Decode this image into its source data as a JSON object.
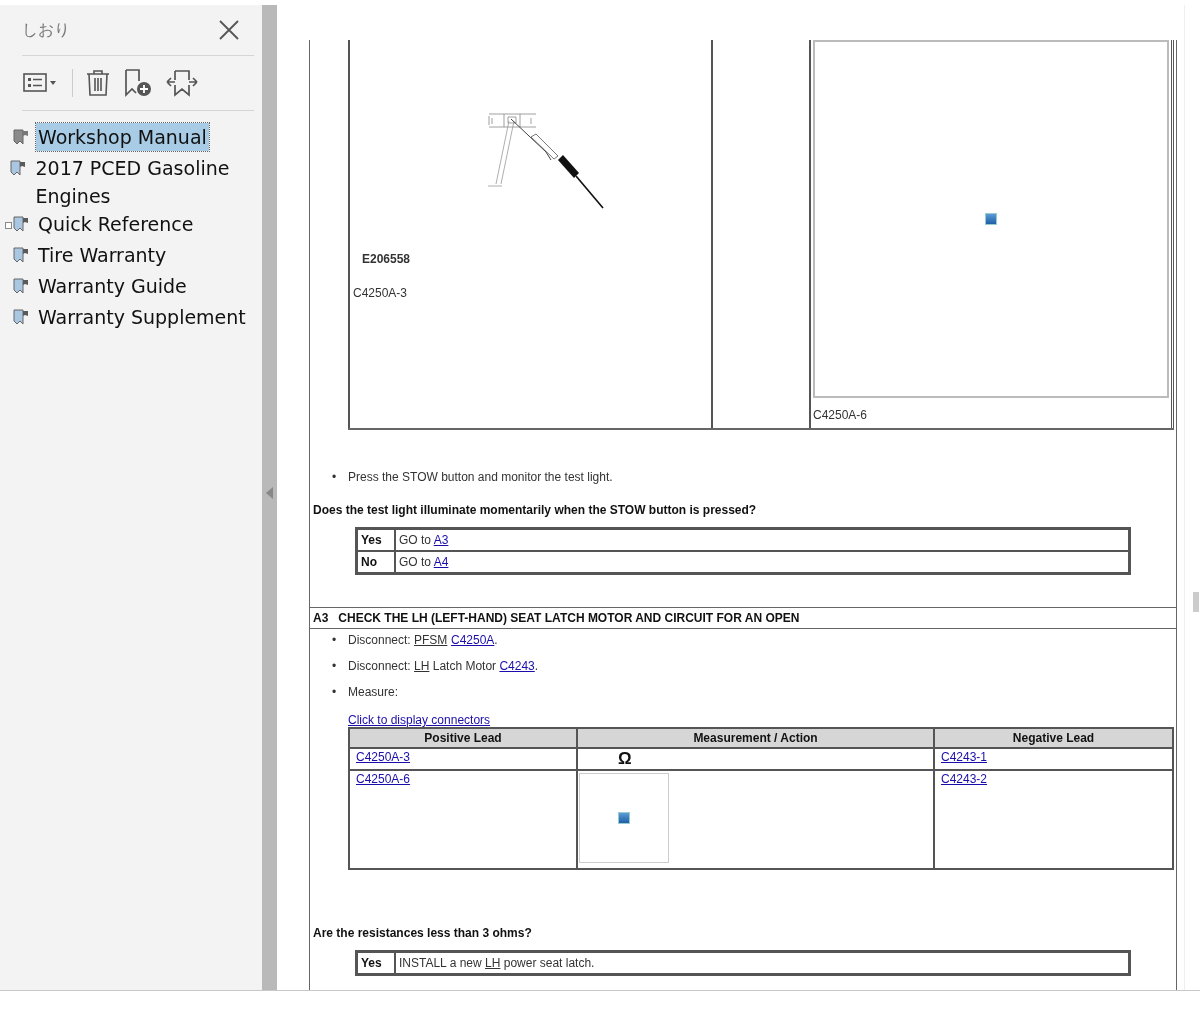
{
  "sidebar": {
    "title": "しおり",
    "bookmarks": [
      {
        "label": "Workshop Manual",
        "selected": true,
        "expandable": false
      },
      {
        "label": "2017 PCED Gasoline Engines",
        "selected": false,
        "expandable": false
      },
      {
        "label": "Quick Reference",
        "selected": false,
        "expandable": true
      },
      {
        "label": "Tire Warranty",
        "selected": false,
        "expandable": false
      },
      {
        "label": "Warranty Guide",
        "selected": false,
        "expandable": false
      },
      {
        "label": "Warranty Supplement",
        "selected": false,
        "expandable": false
      }
    ]
  },
  "document": {
    "figure_table": {
      "figure_id": "E206558",
      "left_caption": "C4250A-3",
      "right_caption": "C4250A-6"
    },
    "step_bullets": [
      {
        "bullet": "•",
        "parts": [
          {
            "kind": "text",
            "text": "Press the STOW button and monitor the test light."
          }
        ]
      }
    ],
    "question": "Does the test light illuminate momentarily when the STOW button is pressed?",
    "answers": [
      {
        "answer": "Yes",
        "parts": [
          {
            "kind": "text",
            "text": "GO to "
          },
          {
            "kind": "link",
            "text": "A3"
          }
        ]
      },
      {
        "answer": "No",
        "parts": [
          {
            "kind": "text",
            "text": "GO to "
          },
          {
            "kind": "link",
            "text": "A4"
          }
        ]
      }
    ],
    "section": {
      "number": "A3",
      "title": "CHECK THE LH (LEFT-HAND) SEAT LATCH MOTOR AND CIRCUIT FOR AN OPEN"
    },
    "section_bullets": [
      {
        "bullet": "•",
        "parts": [
          {
            "kind": "text",
            "text": "Disconnect: "
          },
          {
            "kind": "abbr",
            "text": "PFSM"
          },
          {
            "kind": "link",
            "text": "C4250A",
            "gap_before": true
          },
          {
            "kind": "text",
            "text": "."
          }
        ]
      },
      {
        "bullet": "•",
        "parts": [
          {
            "kind": "text",
            "text": "Disconnect: "
          },
          {
            "kind": "abbr",
            "text": "LH"
          },
          {
            "kind": "text",
            "text": " Latch Motor "
          },
          {
            "kind": "link",
            "text": "C4243"
          },
          {
            "kind": "text",
            "text": "."
          }
        ]
      },
      {
        "bullet": "•",
        "parts": [
          {
            "kind": "text",
            "text": "Measure:"
          }
        ]
      }
    ],
    "connectors_link": "Click to display connectors",
    "measure_table": {
      "columns": [
        "Positive Lead",
        "Measurement / Action",
        "Negative Lead"
      ],
      "rows": [
        {
          "positive": "C4250A-3",
          "measurement": {
            "kind": "symbol",
            "text": "Ω"
          },
          "negative": "C4243-1"
        },
        {
          "positive": "C4250A-6",
          "measurement": {
            "kind": "image"
          },
          "negative": "C4243-2"
        }
      ]
    },
    "question_2": "Are the resistances less than 3 ohms?",
    "answers_2": [
      {
        "answer": "Yes",
        "parts": [
          {
            "kind": "text",
            "text": "INSTALL a new "
          },
          {
            "kind": "abbr",
            "text": "LH"
          },
          {
            "kind": "text",
            "text": " power seat latch."
          }
        ]
      }
    ]
  }
}
